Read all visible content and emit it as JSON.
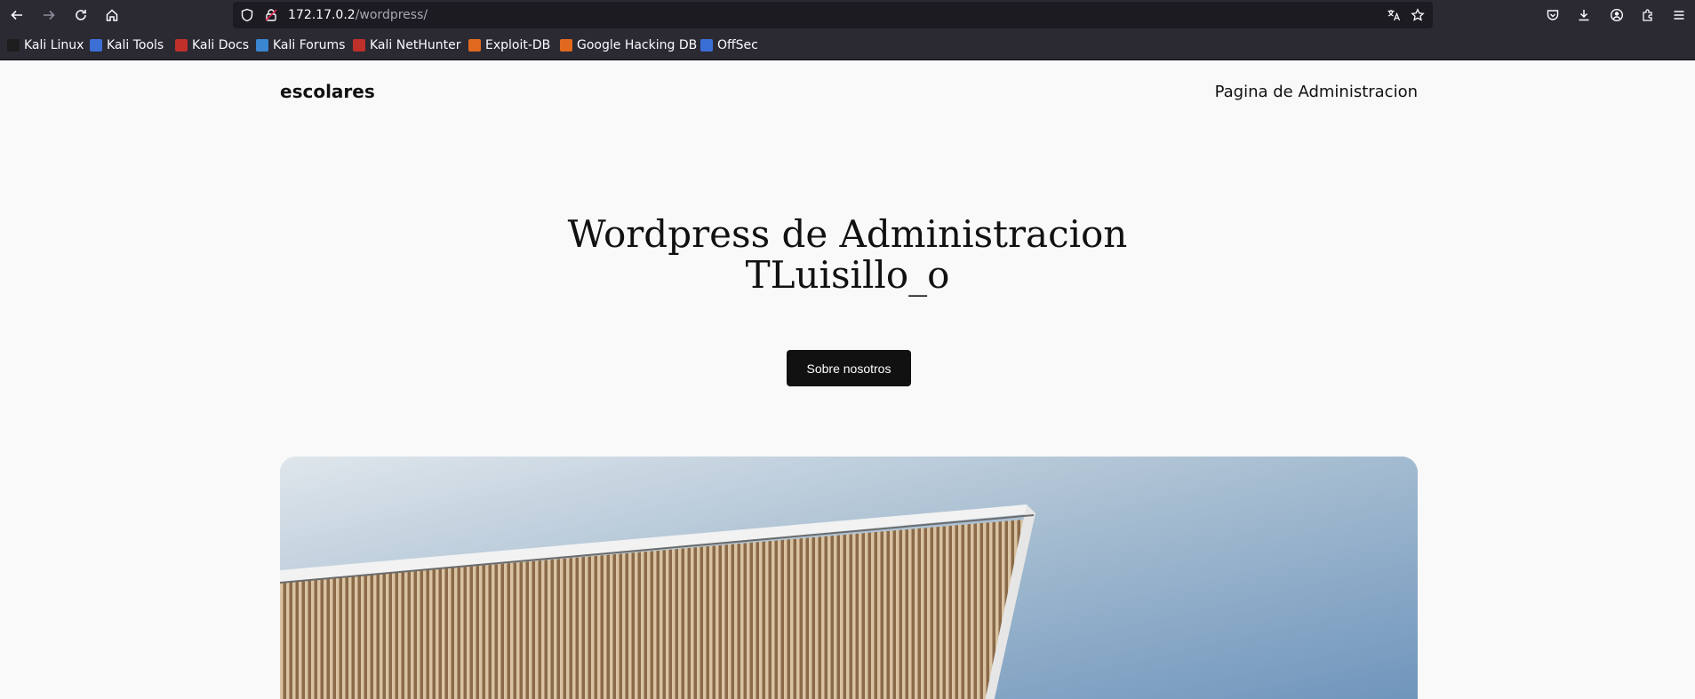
{
  "browser": {
    "url_host": "172.17.0.2",
    "url_path": "/wordpress/",
    "bookmarks": [
      {
        "label": "Kali Linux",
        "color": "#1e1e1e"
      },
      {
        "label": "Kali Tools",
        "color": "#3b6fd6"
      },
      {
        "label": "Kali Docs",
        "color": "#c0302b"
      },
      {
        "label": "Kali Forums",
        "color": "#3a86d0"
      },
      {
        "label": "Kali NetHunter",
        "color": "#c0302b"
      },
      {
        "label": "Exploit-DB",
        "color": "#e0691f"
      },
      {
        "label": "Google Hacking DB",
        "color": "#e0691f"
      },
      {
        "label": "OffSec",
        "color": "#3a6fd6"
      }
    ]
  },
  "site": {
    "title": "escolares",
    "nav_admin": "Pagina de Administracion",
    "hero_line1": "Wordpress de Administracion",
    "hero_line2": "TLuisillo_o",
    "cta": "Sobre nosotros"
  }
}
